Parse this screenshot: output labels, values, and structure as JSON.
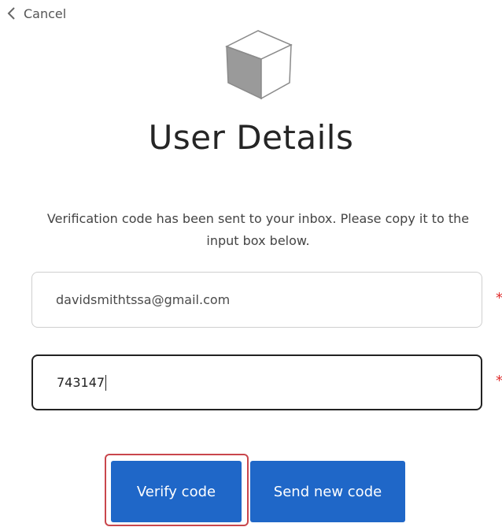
{
  "nav": {
    "cancel_label": "Cancel"
  },
  "header": {
    "title": "User Details",
    "logo_icon": "cube-icon"
  },
  "form": {
    "instruction": "Verification code has been sent to your inbox. Please copy it to the input box below.",
    "email_value": "davidsmithtssa@gmail.com",
    "code_value": "743147",
    "required_marker": "*"
  },
  "actions": {
    "verify_label": "Verify code",
    "send_new_label": "Send new code"
  },
  "colors": {
    "primary_button": "#1f67c8",
    "required": "#e03030",
    "highlight": "#c9464c"
  }
}
